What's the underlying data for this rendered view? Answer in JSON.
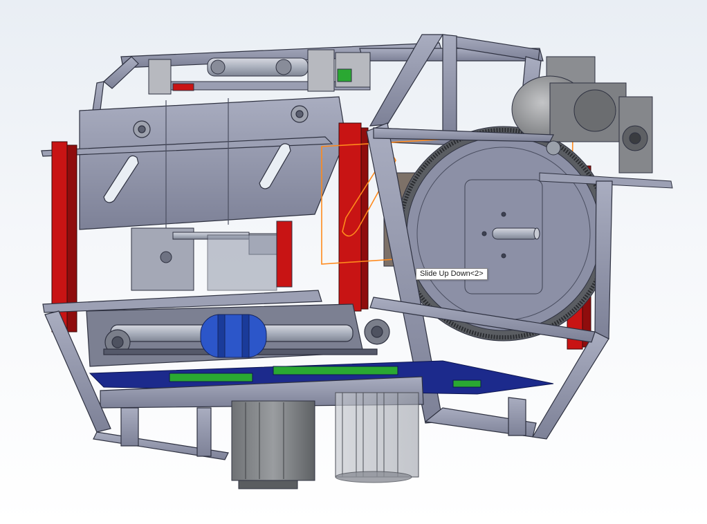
{
  "viewport": {
    "background_top": "#e9eef4",
    "background_bottom": "#ffffff"
  },
  "model": {
    "frame_color": "#8e92a8",
    "frame_edge": "#2e3140",
    "highlight_color": "#ff8a1c",
    "accent_red": "#c81414",
    "coupling_blue": "#2c56c9",
    "board_color": "#1c2a8c",
    "pcb_green": "#2aa832"
  },
  "tooltip": {
    "label": "Slide Up Down<2>"
  }
}
